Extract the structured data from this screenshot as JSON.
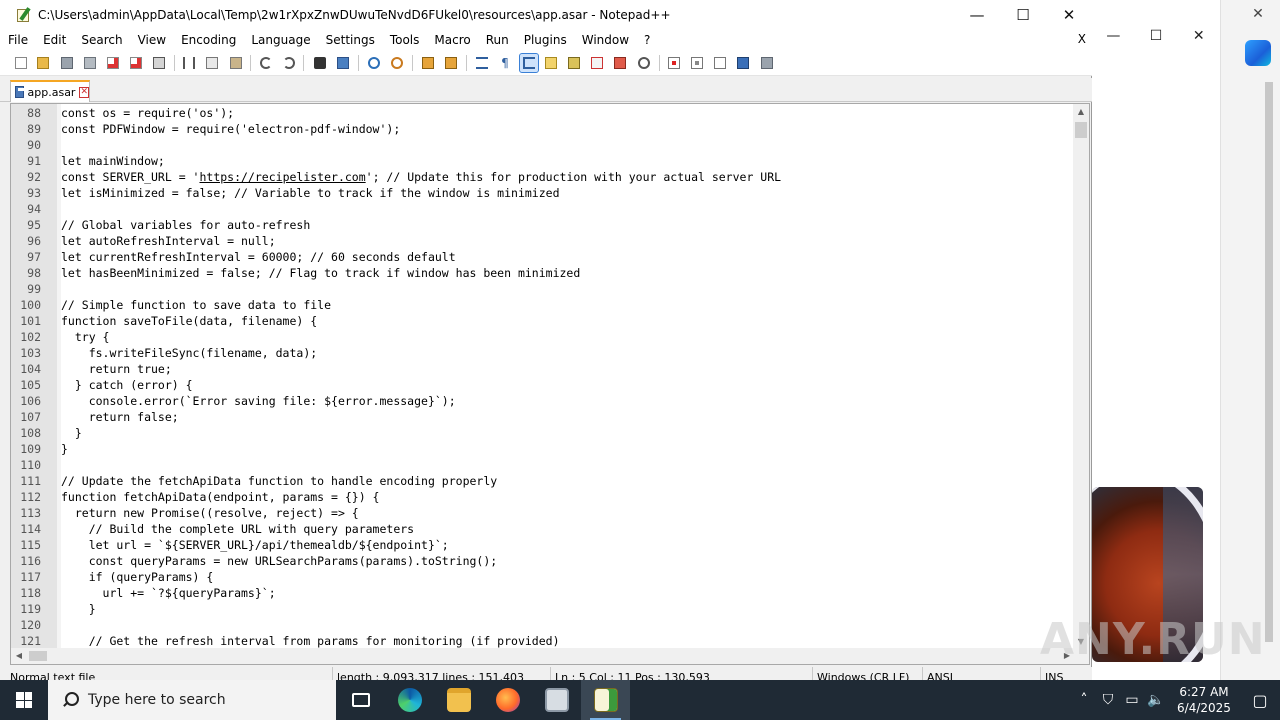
{
  "window": {
    "title": "C:\\Users\\admin\\AppData\\Local\\Temp\\2w1rXpxZnwDUwuTeNvdD6FUkel0\\resources\\app.asar - Notepad++",
    "minimize": "—",
    "maximize": "☐",
    "close": "✕"
  },
  "menu": {
    "items": [
      "File",
      "Edit",
      "Search",
      "View",
      "Encoding",
      "Language",
      "Settings",
      "Tools",
      "Macro",
      "Run",
      "Plugins",
      "Window",
      "?"
    ],
    "close_doc": "X"
  },
  "tab": {
    "label": "app.asar",
    "close": "✕"
  },
  "editor": {
    "lines": [
      {
        "n": "88",
        "text": "const os = require('os');"
      },
      {
        "n": "89",
        "text": "const PDFWindow = require('electron-pdf-window');"
      },
      {
        "n": "90",
        "text": ""
      },
      {
        "n": "91",
        "text": "let mainWindow;"
      },
      {
        "n": "92",
        "text": "const SERVER_URL = 'https://recipelister.com'; // Update this for production with your actual server URL"
      },
      {
        "n": "93",
        "text": "let isMinimized = false; // Variable to track if the window is minimized"
      },
      {
        "n": "94",
        "text": ""
      },
      {
        "n": "95",
        "text": "// Global variables for auto-refresh"
      },
      {
        "n": "96",
        "text": "let autoRefreshInterval = null;"
      },
      {
        "n": "97",
        "text": "let currentRefreshInterval = 60000; // 60 seconds default"
      },
      {
        "n": "98",
        "text": "let hasBeenMinimized = false; // Flag to track if window has been minimized"
      },
      {
        "n": "99",
        "text": ""
      },
      {
        "n": "100",
        "text": "// Simple function to save data to file"
      },
      {
        "n": "101",
        "text": "function saveToFile(data, filename) {"
      },
      {
        "n": "102",
        "text": "  try {"
      },
      {
        "n": "103",
        "text": "    fs.writeFileSync(filename, data);"
      },
      {
        "n": "104",
        "text": "    return true;"
      },
      {
        "n": "105",
        "text": "  } catch (error) {"
      },
      {
        "n": "106",
        "text": "    console.error(`Error saving file: ${error.message}`);"
      },
      {
        "n": "107",
        "text": "    return false;"
      },
      {
        "n": "108",
        "text": "  }"
      },
      {
        "n": "109",
        "text": "}"
      },
      {
        "n": "110",
        "text": ""
      },
      {
        "n": "111",
        "text": "// Update the fetchApiData function to handle encoding properly"
      },
      {
        "n": "112",
        "text": "function fetchApiData(endpoint, params = {}) {"
      },
      {
        "n": "113",
        "text": "  return new Promise((resolve, reject) => {"
      },
      {
        "n": "114",
        "text": "    // Build the complete URL with query parameters"
      },
      {
        "n": "115",
        "text": "    let url = `${SERVER_URL}/api/themealdb/${endpoint}`;"
      },
      {
        "n": "116",
        "text": "    const queryParams = new URLSearchParams(params).toString();"
      },
      {
        "n": "117",
        "text": "    if (queryParams) {"
      },
      {
        "n": "118",
        "text": "      url += `?${queryParams}`;"
      },
      {
        "n": "119",
        "text": "    }"
      },
      {
        "n": "120",
        "text": ""
      },
      {
        "n": "121",
        "text": "    // Get the refresh interval from params for monitoring (if provided)"
      }
    ],
    "link_text": "https://recipelister.com"
  },
  "statusbar": {
    "type": "Normal text file",
    "length": "length : 9,093,317   lines : 151,403",
    "position": "Ln : 5    Col : 11    Pos : 130,593",
    "eol": "Windows (CR LF)",
    "encoding": "ANSI",
    "mode": "INS"
  },
  "background_window": {
    "minimize": "—",
    "maximize": "☐",
    "close": "✕",
    "sidebar_close": "✕"
  },
  "watermark": "ANY.RUN",
  "taskbar": {
    "search_placeholder": "Type here to search",
    "apps": [
      "task-view",
      "edge",
      "file-explorer",
      "firefox",
      "unknown-app",
      "notepad-plus-plus"
    ],
    "active_app": "notepad-plus-plus",
    "time": "6:27 AM",
    "date": "6/4/2025"
  }
}
